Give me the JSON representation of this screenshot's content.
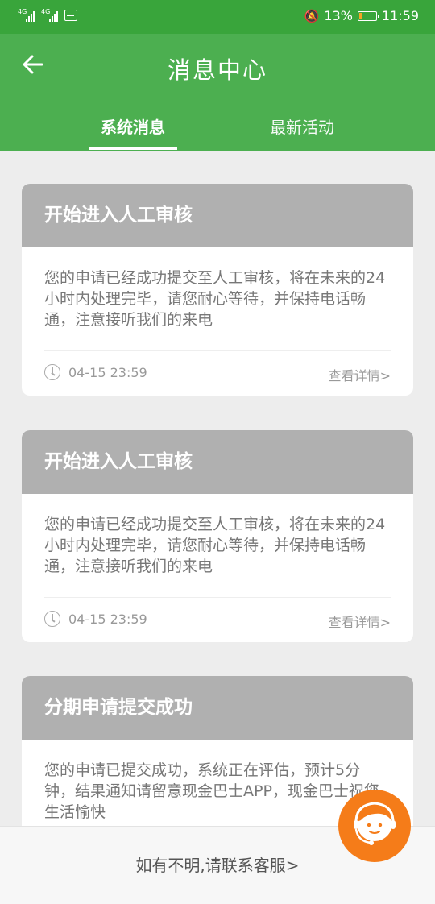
{
  "status": {
    "left_tags": [
      "4G",
      "4G"
    ],
    "battery_text": "13%",
    "battery_level": 0.13,
    "time": "11:59"
  },
  "header": {
    "back_icon": "arrow-left-icon",
    "title": "消息中心",
    "tabs": [
      {
        "label": "系统消息",
        "active": true
      },
      {
        "label": "最新活动",
        "active": false
      }
    ]
  },
  "messages": [
    {
      "title": "开始进入人工审核",
      "body": "您的申请已经成功提交至人工审核，将在未来的24小时内处理完毕，请您耐心等待，并保持电话畅通，注意接听我们的来电",
      "time": "04-15 23:59",
      "detail": "查看详情>"
    },
    {
      "title": "开始进入人工审核",
      "body": "您的申请已经成功提交至人工审核，将在未来的24小时内处理完毕，请您耐心等待，并保持电话畅通，注意接听我们的来电",
      "time": "04-15 23:59",
      "detail": "查看详情>"
    },
    {
      "title": "分期申请提交成功",
      "body": "您的申请已提交成功，系统正在评估，预计5分钟，结果通知请留意现金巴士APP，现金巴士祝您生活愉快"
    }
  ],
  "footer": {
    "contact": "如有不明,请联系客服>"
  },
  "colors": {
    "status_bar": "#39a53b",
    "header": "#4caf50",
    "card_title_bg": "#b0b0b0",
    "service_button": "#f57c19"
  },
  "service_icon": "customer-service-icon"
}
